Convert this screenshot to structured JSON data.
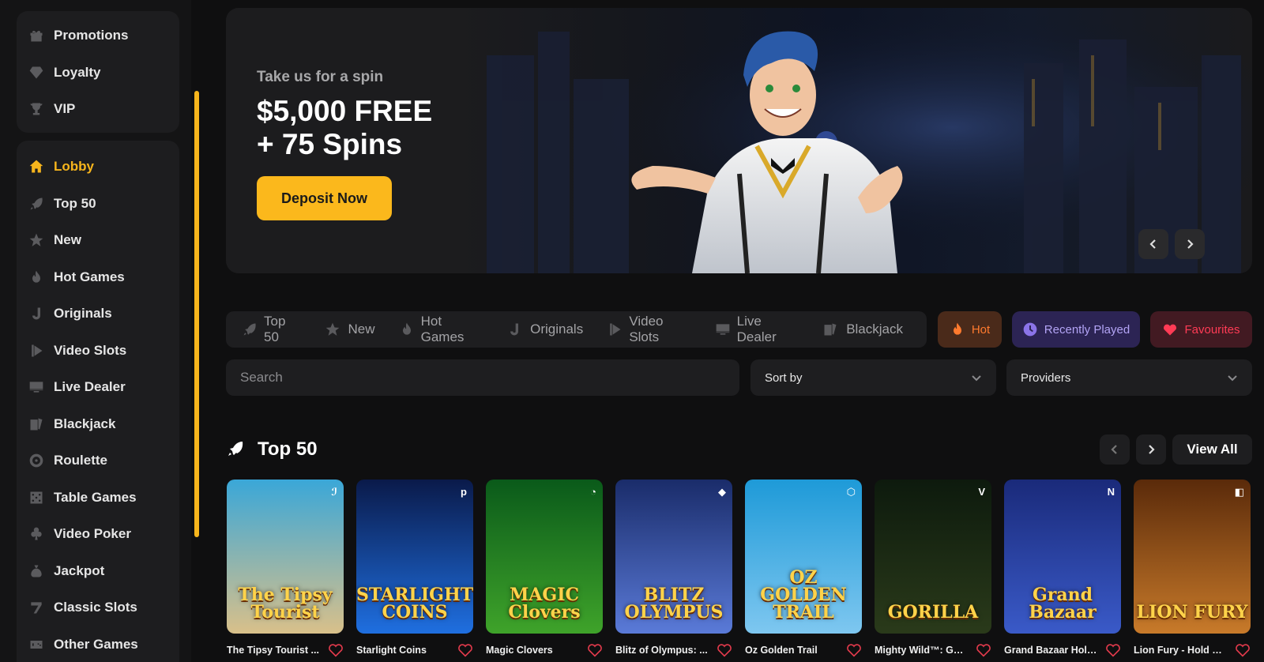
{
  "sidebar": {
    "top_items": [
      {
        "label": "Promotions",
        "icon": "gift-icon"
      },
      {
        "label": "Loyalty",
        "icon": "diamond-icon"
      },
      {
        "label": "VIP",
        "icon": "trophy-icon"
      }
    ],
    "main_items": [
      {
        "label": "Lobby",
        "icon": "home-icon",
        "active": true
      },
      {
        "label": "Top 50",
        "icon": "rocket-icon"
      },
      {
        "label": "New",
        "icon": "star-icon"
      },
      {
        "label": "Hot Games",
        "icon": "flame-icon"
      },
      {
        "label": "Originals",
        "icon": "j-icon"
      },
      {
        "label": "Video Slots",
        "icon": "play-icon"
      },
      {
        "label": "Live Dealer",
        "icon": "monitor-icon"
      },
      {
        "label": "Blackjack",
        "icon": "cards-icon"
      },
      {
        "label": "Roulette",
        "icon": "roulette-icon"
      },
      {
        "label": "Table Games",
        "icon": "dice-icon"
      },
      {
        "label": "Video Poker",
        "icon": "club-icon"
      },
      {
        "label": "Jackpot",
        "icon": "money-bag-icon"
      },
      {
        "label": "Classic Slots",
        "icon": "seven-icon"
      },
      {
        "label": "Other Games",
        "icon": "controller-icon"
      }
    ]
  },
  "hero": {
    "subtitle": "Take us for a spin",
    "title_line1": "$5,000 FREE",
    "title_line2": "+ 75 Spins",
    "cta": "Deposit Now"
  },
  "tabs": [
    {
      "label": "Top 50",
      "icon": "rocket-icon"
    },
    {
      "label": "New",
      "icon": "star-icon"
    },
    {
      "label": "Hot Games",
      "icon": "flame-icon"
    },
    {
      "label": "Originals",
      "icon": "j-icon"
    },
    {
      "label": "Video Slots",
      "icon": "play-icon"
    },
    {
      "label": "Live Dealer",
      "icon": "monitor-icon"
    },
    {
      "label": "Blackjack",
      "icon": "cards-icon"
    }
  ],
  "pills": {
    "hot": "Hot",
    "recent": "Recently Played",
    "favourites": "Favourites"
  },
  "filters": {
    "search_placeholder": "Search",
    "sort_label": "Sort by",
    "providers_label": "Providers"
  },
  "section": {
    "title": "Top 50",
    "view_all": "View All"
  },
  "games": [
    {
      "name": "The Tipsy Tourist ...",
      "art": "The Tipsy Tourist",
      "provider_mark": "ℐ",
      "bg1": "#3aa7d8",
      "bg2": "#d9c08a"
    },
    {
      "name": "Starlight Coins",
      "art": "STARLIGHT COINS",
      "provider_mark": "p",
      "bg1": "#0a1a4a",
      "bg2": "#1f6fe0"
    },
    {
      "name": "Magic Clovers",
      "art": "MAGIC Clovers",
      "provider_mark": "◔",
      "bg1": "#0a5a1a",
      "bg2": "#3fa32a"
    },
    {
      "name": "Blitz of Olympus: ...",
      "art": "BLITZ OLYMPUS",
      "provider_mark": "◆",
      "bg1": "#1a2c6a",
      "bg2": "#5a7ad8"
    },
    {
      "name": "Oz Golden Trail",
      "art": "OZ GOLDEN TRAIL",
      "provider_mark": "⬡",
      "bg1": "#1e9ad8",
      "bg2": "#7ec7f0"
    },
    {
      "name": "Mighty Wild™: Gor...",
      "art": "GORILLA",
      "provider_mark": "V",
      "bg1": "#0d1a0d",
      "bg2": "#2a3a1a"
    },
    {
      "name": "Grand Bazaar Hold...",
      "art": "Grand Bazaar",
      "provider_mark": "N",
      "bg1": "#1a2a7a",
      "bg2": "#3a5ac8"
    },
    {
      "name": "Lion Fury - Hold & ...",
      "art": "LION FURY",
      "provider_mark": "◧",
      "bg1": "#5a2a0a",
      "bg2": "#c87a2a"
    }
  ],
  "colors": {
    "accent": "#fbb81c",
    "hot": "#ff7a2e",
    "recent": "#b3a4f5",
    "favourite": "#ff3b55"
  }
}
